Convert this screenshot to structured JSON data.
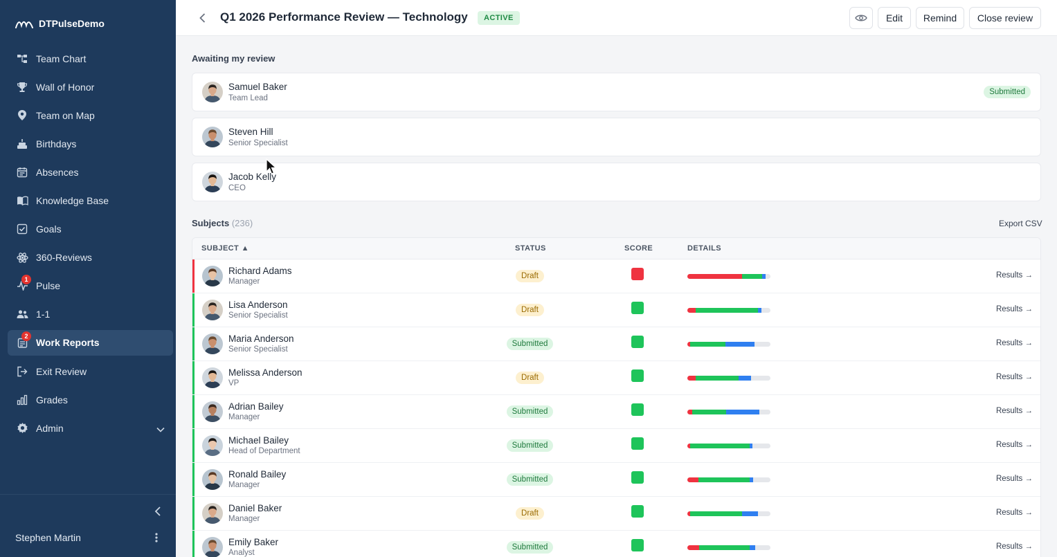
{
  "app": {
    "brand": "DTPulseDemo"
  },
  "sidebar": {
    "items": [
      {
        "label": "Team Chart",
        "icon": "org-chart-icon"
      },
      {
        "label": "Wall of Honor",
        "icon": "trophy-icon"
      },
      {
        "label": "Team on Map",
        "icon": "map-pin-icon"
      },
      {
        "label": "Birthdays",
        "icon": "cake-icon"
      },
      {
        "label": "Absences",
        "icon": "calendar-icon"
      },
      {
        "label": "Knowledge Base",
        "icon": "book-icon"
      },
      {
        "label": "Goals",
        "icon": "checkbox-icon"
      },
      {
        "label": "360-Reviews",
        "icon": "atom-icon"
      },
      {
        "label": "Pulse",
        "icon": "pulse-icon",
        "badge": "1"
      },
      {
        "label": "1-1",
        "icon": "people-icon"
      },
      {
        "label": "Work Reports",
        "icon": "report-icon",
        "badge": "2",
        "active": true
      },
      {
        "label": "Exit Review",
        "icon": "exit-icon"
      },
      {
        "label": "Grades",
        "icon": "bar-chart-icon"
      },
      {
        "label": "Admin",
        "icon": "gear-icon",
        "expandable": true
      }
    ],
    "user": {
      "name": "Stephen Martin"
    }
  },
  "header": {
    "title": "Q1 2026 Performance Review — Technology",
    "status": "ACTIVE",
    "buttons": {
      "edit": "Edit",
      "remind": "Remind",
      "close": "Close review"
    }
  },
  "awaiting": {
    "title": "Awaiting my review",
    "people": [
      {
        "name": "Samuel Baker",
        "role": "Team Lead",
        "status": "Submitted"
      },
      {
        "name": "Steven Hill",
        "role": "Senior Specialist",
        "status": ""
      },
      {
        "name": "Jacob Kelly",
        "role": "CEO",
        "status": ""
      }
    ]
  },
  "subjects": {
    "title": "Subjects",
    "count": "(236)",
    "export": "Export CSV",
    "columns": {
      "subject": "SUBJECT ▲",
      "status": "STATUS",
      "score": "SCORE",
      "details": "DETAILS"
    },
    "results_label": "Results →",
    "colors": {
      "red": "#ef3340",
      "green": "#1ec45a",
      "blue": "#2f7ff0"
    },
    "rows": [
      {
        "name": "Richard Adams",
        "role": "Manager",
        "status": "Draft",
        "score": "red",
        "details": [
          0.66,
          0.24,
          0.04
        ]
      },
      {
        "name": "Lisa Anderson",
        "role": "Senior Specialist",
        "status": "Draft",
        "score": "green",
        "details": [
          0.1,
          0.75,
          0.04
        ]
      },
      {
        "name": "Maria Anderson",
        "role": "Senior Specialist",
        "status": "Submitted",
        "score": "green",
        "details": [
          0.03,
          0.43,
          0.35
        ]
      },
      {
        "name": "Melissa Anderson",
        "role": "VP",
        "status": "Draft",
        "score": "green",
        "details": [
          0.1,
          0.52,
          0.15
        ]
      },
      {
        "name": "Adrian Bailey",
        "role": "Manager",
        "status": "Submitted",
        "score": "green",
        "details": [
          0.06,
          0.41,
          0.4
        ]
      },
      {
        "name": "Michael Bailey",
        "role": "Head of Department",
        "status": "Submitted",
        "score": "green",
        "details": [
          0.03,
          0.72,
          0.03
        ]
      },
      {
        "name": "Ronald Bailey",
        "role": "Manager",
        "status": "Submitted",
        "score": "green",
        "details": [
          0.13,
          0.62,
          0.04
        ]
      },
      {
        "name": "Daniel Baker",
        "role": "Manager",
        "status": "Draft",
        "score": "green",
        "details": [
          0.03,
          0.63,
          0.19
        ]
      },
      {
        "name": "Emily Baker",
        "role": "Analyst",
        "status": "Submitted",
        "score": "green",
        "details": [
          0.14,
          0.61,
          0.07
        ]
      }
    ]
  }
}
